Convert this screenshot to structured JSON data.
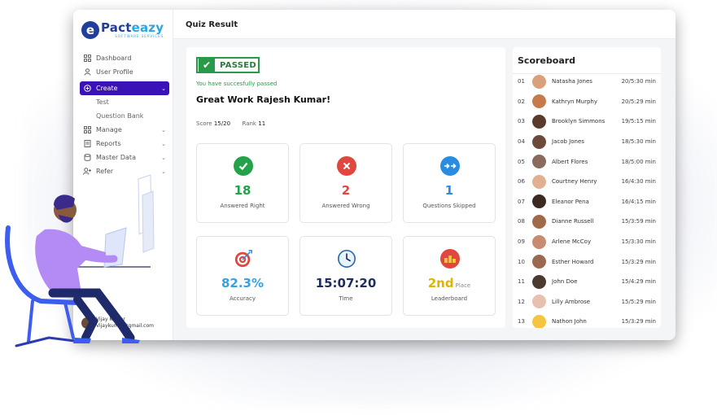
{
  "app": {
    "logo_name_a": "Pact",
    "logo_name_b": "eazy",
    "logo_sub": "SOFTWARE SERVICES",
    "logo_mark": "e"
  },
  "sidebar": {
    "items": [
      {
        "label": "Dashboard",
        "icon": "grid-icon"
      },
      {
        "label": "User Profile",
        "icon": "user-icon"
      },
      {
        "label": "Create",
        "icon": "plus-circle-icon",
        "active": true
      },
      {
        "label": "Manage",
        "icon": "grid-icon"
      },
      {
        "label": "Reports",
        "icon": "report-icon"
      },
      {
        "label": "Master Data",
        "icon": "database-icon"
      },
      {
        "label": "Refer",
        "icon": "user-plus-icon"
      }
    ],
    "sub_items": [
      "Test",
      "Question Bank"
    ]
  },
  "user": {
    "name": "Vijay Kumar",
    "email": "Vijaykumar@gmail.com"
  },
  "header": {
    "title": "Quiz Result"
  },
  "result": {
    "badge": "PASSED",
    "message": "You have succesfully passed",
    "greeting": "Great Work Rajesh Kumar!",
    "score_label": "Score",
    "score_value": "15/20",
    "rank_label": "Rank",
    "rank_value": "11",
    "stats": [
      {
        "value": "18",
        "label": "Answered Right",
        "icon": "check-icon",
        "color": "#22a34a",
        "icon_bg": "#22a34a"
      },
      {
        "value": "2",
        "label": "Answered Wrong",
        "icon": "x-icon",
        "color": "#e0473e",
        "icon_bg": "#e0473e"
      },
      {
        "value": "1",
        "label": "Questions Skipped",
        "icon": "skip-icon",
        "color": "#2a8ce0",
        "icon_bg": "#2a8ce0"
      },
      {
        "value": "82.3%",
        "label": "Accuracy",
        "icon": "target-icon",
        "color": "#3aa0e0",
        "icon_bg": "#ffffff"
      },
      {
        "value": "15:07:20",
        "label": "Time",
        "icon": "clock-icon",
        "color": "#1e2f5e",
        "icon_bg": "#ffffff"
      },
      {
        "value": "2nd",
        "suffix": "Place",
        "label": "Leaderboard",
        "icon": "podium-icon",
        "color": "#e0b400",
        "icon_bg": "#e0473e"
      }
    ]
  },
  "scoreboard": {
    "title": "Scoreboard",
    "rows": [
      {
        "rank": "01",
        "name": "Natasha Jones",
        "score": "20/5:30 min"
      },
      {
        "rank": "02",
        "name": "Kathryn Murphy",
        "score": "20/5:29 min"
      },
      {
        "rank": "03",
        "name": "Brooklyn Simmons",
        "score": "19/5:15 min"
      },
      {
        "rank": "04",
        "name": "Jacob Jones",
        "score": "18/5:30 min"
      },
      {
        "rank": "05",
        "name": "Albert Flores",
        "score": "18/5:00 min"
      },
      {
        "rank": "06",
        "name": "Courtney Henry",
        "score": "16/4:30 min"
      },
      {
        "rank": "07",
        "name": "Eleanor Pena",
        "score": "16/4:15 min"
      },
      {
        "rank": "08",
        "name": "Dianne Russell",
        "score": "15/3:59 min"
      },
      {
        "rank": "09",
        "name": "Arlene McCoy",
        "score": "15/3:30 min"
      },
      {
        "rank": "10",
        "name": "Esther Howard",
        "score": "15/3:29 min"
      },
      {
        "rank": "11",
        "name": "John Doe",
        "score": "15/4:29 min"
      },
      {
        "rank": "12",
        "name": "Lilly Ambrose",
        "score": "15/5:29 min"
      },
      {
        "rank": "13",
        "name": "Nathon John",
        "score": "15/3:29 min"
      }
    ]
  }
}
